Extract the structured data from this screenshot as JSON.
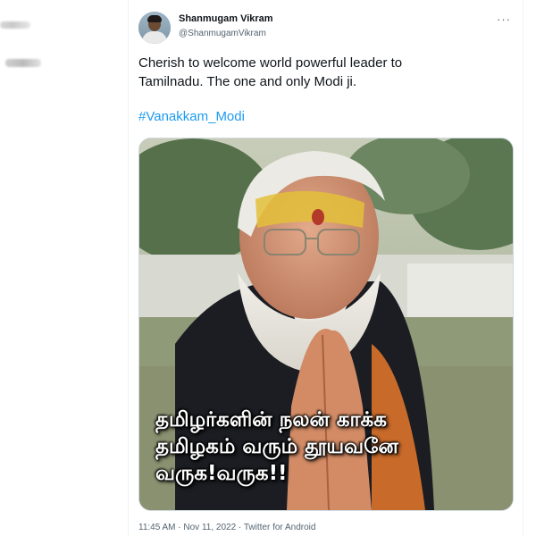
{
  "tweet": {
    "author_name": "Shanmugam Vikram",
    "author_handle": "@ShanmugamVikram",
    "more_icon": "more-dots-icon",
    "text_line1": "Cherish to welcome world powerful leader to",
    "text_line2": "Tamilnadu. The one and only Modi ji.",
    "hashtag": "#Vanakkam_Modi",
    "image_caption": [
      "தமிழர்களின் நலன் காக்க",
      "தமிழகம் வரும் தூயவனே",
      "வருக!வருக!!"
    ],
    "timestamp": "11:45 AM · Nov 11, 2022 · Twitter for Android"
  },
  "colors": {
    "link": "#1d9bf0",
    "text_primary": "#0f1419",
    "text_secondary": "#536471"
  }
}
